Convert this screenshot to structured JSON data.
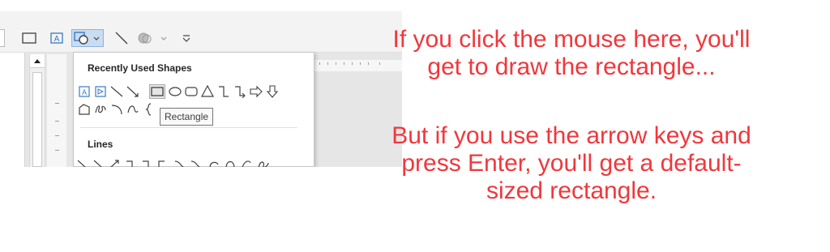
{
  "gallery": {
    "section_recent": "Recently Used Shapes",
    "section_lines": "Lines",
    "tooltip": "Rectangle"
  },
  "annotation": {
    "line1": "If you click the mouse here, you'll",
    "line2": "get to draw the rectangle...",
    "line3": "But if you use the arrow keys and",
    "line4": "press Enter, you'll get a default-",
    "line5": "sized rectangle."
  },
  "colors": {
    "annotation": "#f0373c",
    "accent_blue": "#3a78c8",
    "icon_gray": "#404040"
  },
  "icons": [
    "shape-rectangle-icon",
    "text-box-icon",
    "shapes-gallery-icon",
    "line-icon",
    "shape-fill-icon",
    "ribbon-options-icon"
  ]
}
